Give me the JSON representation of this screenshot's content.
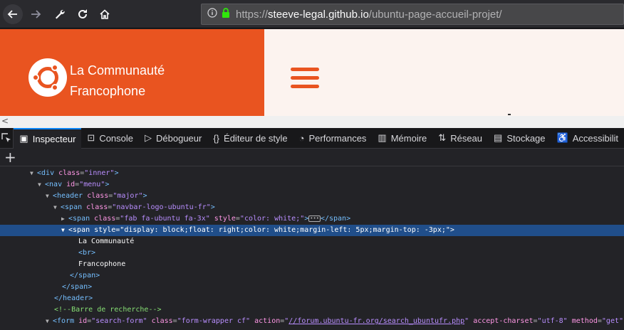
{
  "browser": {
    "url_protocol": "https://",
    "url_host": "steeve-legal.github.io",
    "url_path": "/ubuntu-page-accueil-projet/"
  },
  "page": {
    "brand_line1": "La Communauté",
    "brand_line2": "Francophone",
    "accent_color": "#e95420"
  },
  "devtools": {
    "tabs": [
      {
        "label": "Inspecteur",
        "icon": "inspector-icon"
      },
      {
        "label": "Console",
        "icon": "console-icon"
      },
      {
        "label": "Débogueur",
        "icon": "debugger-icon"
      },
      {
        "label": "Éditeur de style",
        "icon": "style-editor-icon"
      },
      {
        "label": "Performances",
        "icon": "performance-icon"
      },
      {
        "label": "Mémoire",
        "icon": "memory-icon"
      },
      {
        "label": "Réseau",
        "icon": "network-icon"
      },
      {
        "label": "Stockage",
        "icon": "storage-icon"
      },
      {
        "label": "Accessibilit",
        "icon": "accessibility-icon"
      }
    ],
    "tree": {
      "l1": {
        "tag": "div",
        "attr": "class",
        "val": "inner"
      },
      "l2": {
        "tag": "nav",
        "attr": "id",
        "val": "menu"
      },
      "l3": {
        "tag": "header",
        "attr": "class",
        "val": "major"
      },
      "l4": {
        "tag": "span",
        "attr": "class",
        "val": "navbar-logo-ubuntu-fr"
      },
      "l5": {
        "tag": "span",
        "attr1": "class",
        "val1": "fab fa-ubuntu fa-3x",
        "attr2": "style",
        "val2": "color: white;",
        "close": "</span>"
      },
      "l6": {
        "tag": "span",
        "attr": "style",
        "val": "display: block;float: right;color: white;margin-left: 5px;margin-top: -3px;"
      },
      "l7": "La Communauté",
      "l8": "<br>",
      "l9": "Francophone",
      "l10": "</span>",
      "l11": "</span>",
      "l12": "</header>",
      "l13": "<!--Barre de recherche-->",
      "l14": {
        "tag": "form",
        "attr1": "id",
        "val1": "search-form",
        "attr2": "class",
        "val2": "form-wrapper cf",
        "attr3": "action",
        "val3": "//forum.ubuntu-fr.org/search_ubuntufr.php",
        "attr4": "accept-charset",
        "val4": "utf-8",
        "attr5": "method",
        "val5": "get"
      }
    }
  }
}
